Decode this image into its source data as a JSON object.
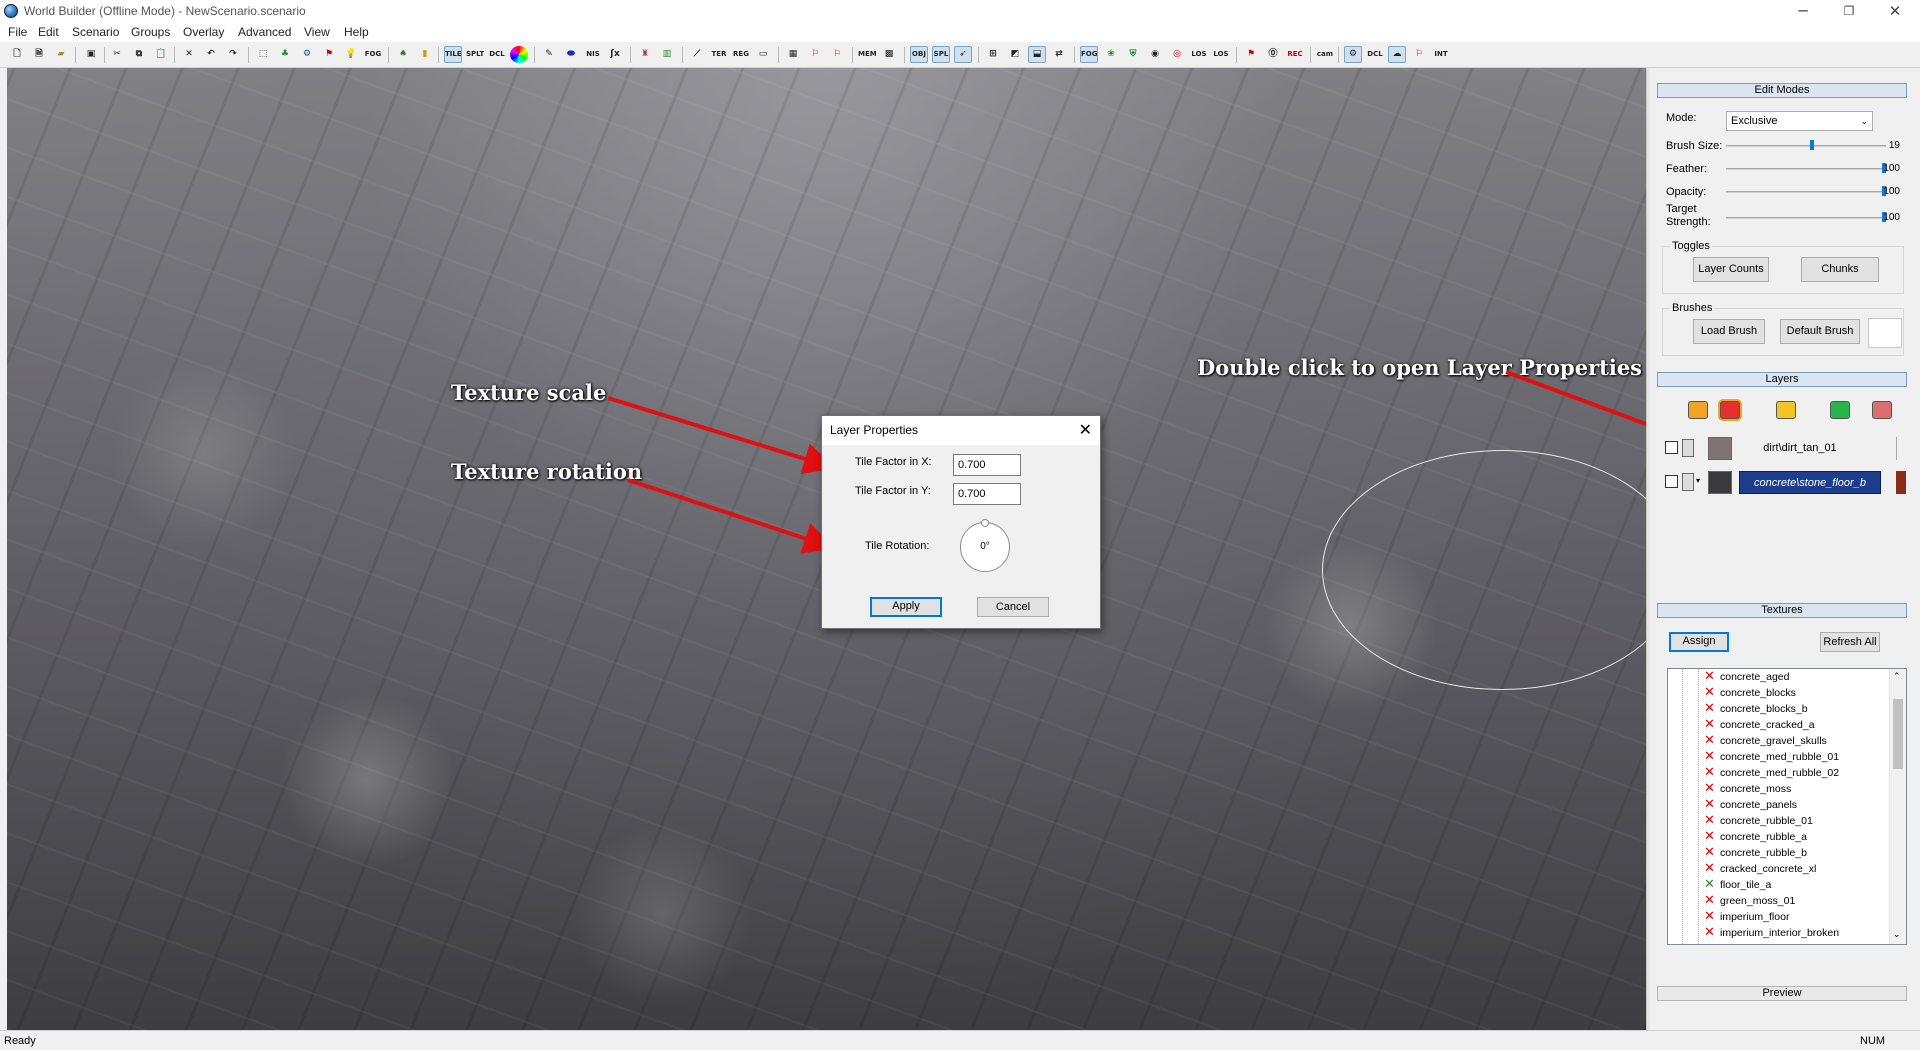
{
  "window": {
    "title": "World Builder (Offline Mode) - NewScenario.scenario",
    "controls": [
      "─",
      "❐",
      "✕"
    ]
  },
  "menu": [
    "File",
    "Edit",
    "Scenario",
    "Groups",
    "Overlay",
    "Advanced",
    "View",
    "Help"
  ],
  "toolbar": {
    "buttons": [
      "new",
      "open",
      "open-folder",
      "save",
      "cut",
      "copy",
      "paste",
      "delete",
      "undo",
      "redo",
      "select",
      "tree",
      "gear",
      "flag",
      "bulb",
      "FOG",
      "bush",
      "torch",
      "TILE",
      "SPLT",
      "DCL",
      "color-wheel",
      "brush",
      "water",
      "NIS",
      "fx",
      "tank",
      "chart",
      "line",
      "TER",
      "REG",
      "frame",
      "grid",
      "marker",
      "marker2",
      "MEM",
      "map",
      "OBJ",
      "SPL",
      "lasso",
      "snap",
      "terrain",
      "pickup",
      "FOG",
      "plant",
      "shield",
      "camera",
      "LOS",
      "LOS",
      "flag",
      "pin",
      "REC",
      "cam",
      "cog",
      "DCL",
      "cloud",
      "map2",
      "INT"
    ]
  },
  "annotations": {
    "texture_scale": "Texture scale",
    "texture_rotation": "Texture rotation",
    "double_click": "Double click to open Layer Properties"
  },
  "dialog": {
    "title": "Layer Properties",
    "tile_x_label": "Tile Factor in X:",
    "tile_x_value": "0.700",
    "tile_y_label": "Tile Factor in Y:",
    "tile_y_value": "0.700",
    "rotation_label": "Tile Rotation:",
    "rotation_value": "0°",
    "apply": "Apply",
    "cancel": "Cancel"
  },
  "edit_modes": {
    "header": "Edit Modes",
    "mode_label": "Mode:",
    "mode_value": "Exclusive",
    "brush_size_label": "Brush Size:",
    "brush_size_value": "19",
    "brush_size_level": 0.19,
    "feather_label": "Feather:",
    "feather_value": "100",
    "opacity_label": "Opacity:",
    "opacity_value": "100",
    "target_strength_label_1": "Target",
    "target_strength_label_2": "Strength:",
    "target_strength_value": "100",
    "toggles_label": "Toggles",
    "layer_counts": "Layer Counts",
    "chunks": "Chunks",
    "brushes_label": "Brushes",
    "load_brush": "Load Brush",
    "default_brush": "Default Brush"
  },
  "layers": {
    "header": "Layers",
    "items": [
      {
        "name": "dirt\\dirt_tan_01",
        "selected": false,
        "swatch": "#7d7473"
      },
      {
        "name": "concrete\\stone_floor_b",
        "selected": true,
        "swatch": "#3a3a3c"
      }
    ]
  },
  "textures": {
    "header": "Textures",
    "assign": "Assign",
    "refresh_all": "Refresh All",
    "items": [
      "concrete_aged",
      "concrete_blocks",
      "concrete_blocks_b",
      "concrete_cracked_a",
      "concrete_gravel_skulls",
      "concrete_med_rubble_01",
      "concrete_med_rubble_02",
      "concrete_moss",
      "concrete_panels",
      "concrete_rubble_01",
      "concrete_rubble_a",
      "concrete_rubble_b",
      "cracked_concrete_xl",
      "floor_tile_a",
      "green_moss_01",
      "imperium_floor",
      "imperium_interior_broken"
    ],
    "preview": "Preview"
  },
  "status": {
    "left": "Ready",
    "right": "NUM"
  },
  "colors": {
    "accent": "#0078d7",
    "selected_layer_bg": "#1e3d8c",
    "arrow": "#e01010",
    "error_x": "#d00000"
  }
}
